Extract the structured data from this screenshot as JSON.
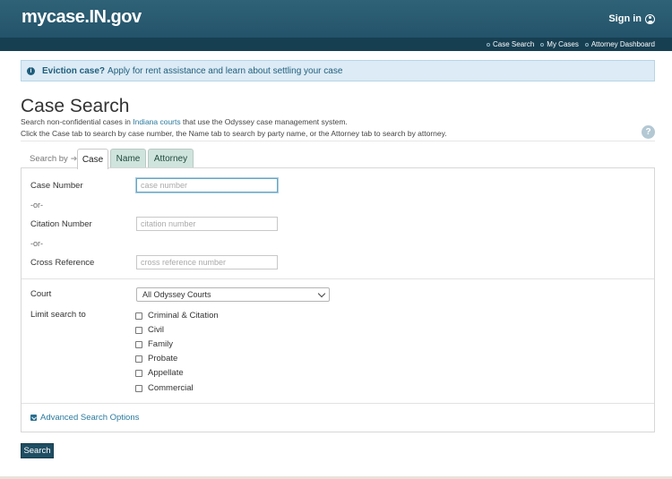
{
  "header": {
    "logo": "mycase.IN.gov",
    "sign_in": "Sign in",
    "nav": [
      "Case Search",
      "My Cases",
      "Attorney Dashboard"
    ]
  },
  "alert": {
    "strong": "Eviction case?",
    "text": "Apply for rent assistance and learn about settling your case"
  },
  "page": {
    "title": "Case Search",
    "desc1_pre": "Search non-confidential cases in",
    "desc1_link": "Indiana courts",
    "desc1_post": "that use the Odyssey case management system.",
    "desc2": "Click the Case tab to search by case number, the Name tab to search by party name, or the Attorney tab to search by attorney."
  },
  "tabs": {
    "search_by": "Search by",
    "items": [
      "Case",
      "Name",
      "Attorney"
    ],
    "active": "Case"
  },
  "form": {
    "case_number_label": "Case Number",
    "case_number_placeholder": "case number",
    "or": "-or-",
    "citation_label": "Citation Number",
    "citation_placeholder": "citation number",
    "cross_ref_label": "Cross Reference",
    "cross_ref_placeholder": "cross reference number",
    "court_label": "Court",
    "court_value": "All Odyssey Courts",
    "limit_label": "Limit search to",
    "case_types": [
      "Criminal & Citation",
      "Civil",
      "Family",
      "Probate",
      "Appellate",
      "Commercial"
    ],
    "advanced": "Advanced Search Options",
    "search_button": "Search"
  }
}
